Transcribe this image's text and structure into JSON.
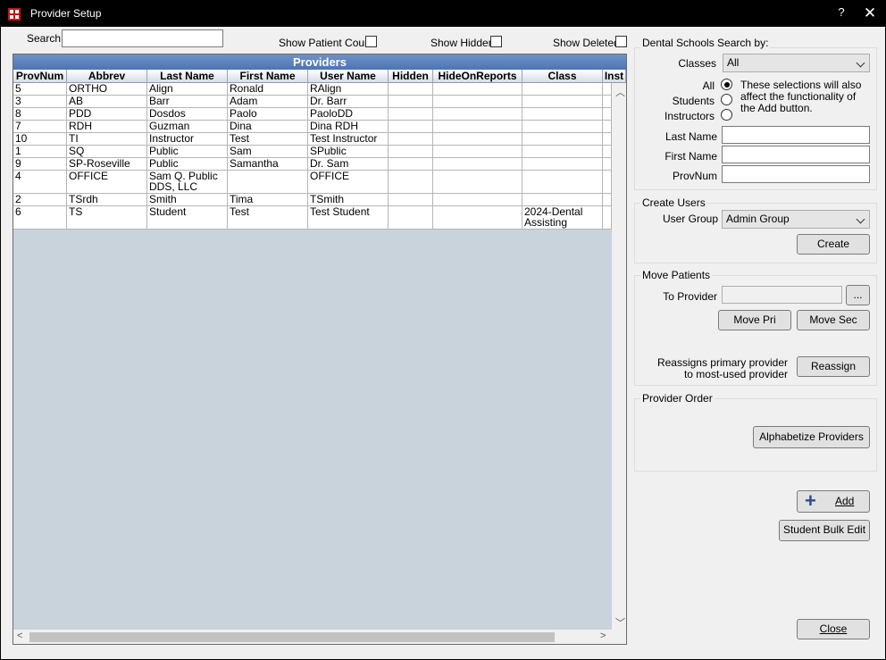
{
  "window": {
    "title": "Provider Setup",
    "help": "?",
    "close_glyph": "✕"
  },
  "filters": {
    "search_label": "Search",
    "search_value": "",
    "show_patient_count": "Show Patient Count",
    "show_hidden": "Show Hidden",
    "show_deleted": "Show Deleted"
  },
  "grid": {
    "title": "Providers",
    "columns": [
      "ProvNum",
      "Abbrev",
      "Last Name",
      "First Name",
      "User Name",
      "Hidden",
      "HideOnReports",
      "Class",
      "Inst"
    ],
    "rows": [
      {
        "provnum": "5",
        "abbrev": "ORTHO",
        "last": "Align",
        "first": "Ronald",
        "user": "RAlign",
        "hidden": "",
        "hide_reports": "",
        "class": ""
      },
      {
        "provnum": "3",
        "abbrev": "AB",
        "last": "Barr",
        "first": "Adam",
        "user": "Dr. Barr",
        "hidden": "",
        "hide_reports": "",
        "class": ""
      },
      {
        "provnum": "8",
        "abbrev": "PDD",
        "last": "Dosdos",
        "first": "Paolo",
        "user": "PaoloDD",
        "hidden": "",
        "hide_reports": "",
        "class": ""
      },
      {
        "provnum": "7",
        "abbrev": "RDH",
        "last": "Guzman",
        "first": "Dina",
        "user": "Dina RDH",
        "hidden": "",
        "hide_reports": "",
        "class": ""
      },
      {
        "provnum": "10",
        "abbrev": "TI",
        "last": "Instructor",
        "first": "Test",
        "user": "Test Instructor",
        "hidden": "",
        "hide_reports": "",
        "class": ""
      },
      {
        "provnum": "1",
        "abbrev": "SQ",
        "last": "Public",
        "first": "Sam",
        "user": "SPublic",
        "hidden": "",
        "hide_reports": "",
        "class": ""
      },
      {
        "provnum": "9",
        "abbrev": "SP-Roseville",
        "last": "Public",
        "first": "Samantha",
        "user": "Dr. Sam",
        "hidden": "",
        "hide_reports": "",
        "class": ""
      },
      {
        "provnum": "4",
        "abbrev": "OFFICE",
        "last": "Sam Q. Public DDS, LLC",
        "first": "",
        "user": "OFFICE",
        "hidden": "",
        "hide_reports": "",
        "class": ""
      },
      {
        "provnum": "2",
        "abbrev": "TSrdh",
        "last": "Smith",
        "first": "Tima",
        "user": "TSmith",
        "hidden": "",
        "hide_reports": "",
        "class": ""
      },
      {
        "provnum": "6",
        "abbrev": "TS",
        "last": "Student",
        "first": "Test",
        "user": "Test Student",
        "hidden": "",
        "hide_reports": "",
        "class": "2024-Dental Assisting"
      }
    ]
  },
  "dental_schools": {
    "title": "Dental Schools Search by:",
    "classes_label": "Classes",
    "classes_value": "All",
    "all_label": "All",
    "students_label": "Students",
    "instructors_label": "Instructors",
    "note": "These selections will also affect the functionality of the Add button.",
    "last_name_label": "Last Name",
    "first_name_label": "First Name",
    "provnum_label": "ProvNum"
  },
  "create_users": {
    "title": "Create Users",
    "user_group_label": "User Group",
    "user_group_value": "Admin Group",
    "create_button": "Create"
  },
  "move_patients": {
    "title": "Move Patients",
    "to_provider_label": "To Provider",
    "ellipsis_button": "...",
    "move_pri_button": "Move Pri",
    "move_sec_button": "Move Sec",
    "reassign_note": "Reassigns primary provider to most-used provider",
    "reassign_button": "Reassign"
  },
  "provider_order": {
    "title": "Provider Order",
    "alphabetize_button": "Alphabetize Providers"
  },
  "actions": {
    "add_button": "Add",
    "student_bulk_edit_button": "Student Bulk Edit",
    "close_button": "Close"
  },
  "colors": {
    "titlebar": "#000000",
    "grid_title": "#5a7fbd",
    "grid_background": "#c9d3dc",
    "add_icon": "#2a4d8f"
  },
  "icons": [
    "app-grid-icon",
    "help-icon",
    "close-icon",
    "dropdown-arrow-icon",
    "plus-icon",
    "scroll-up-icon",
    "scroll-down-icon",
    "scroll-left-icon",
    "scroll-right-icon"
  ]
}
